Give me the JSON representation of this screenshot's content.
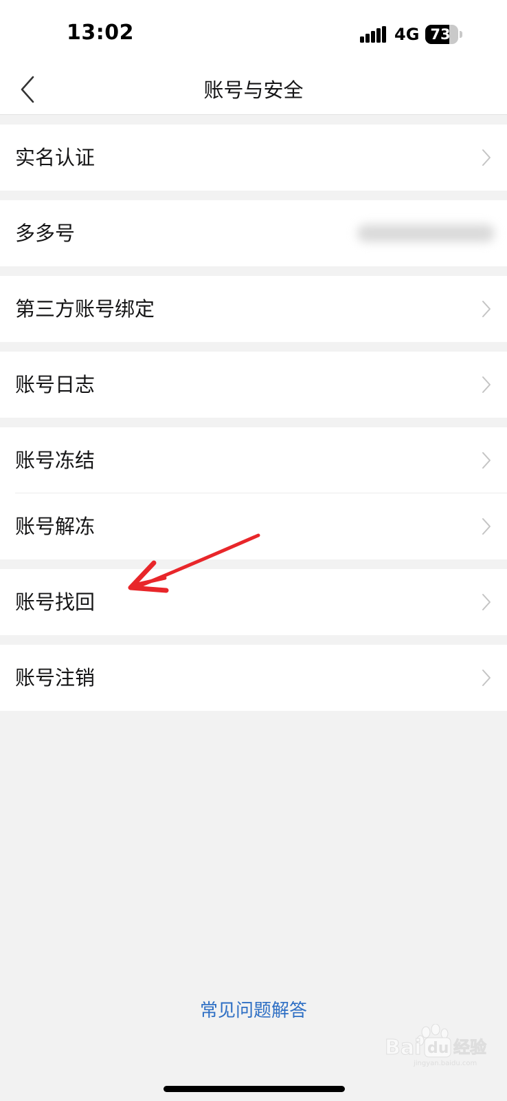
{
  "status_bar": {
    "time": "13:02",
    "network": "4G",
    "battery_percent": "73",
    "battery_level": 0.73
  },
  "nav": {
    "title": "账号与安全",
    "back_icon": "chevron-left-icon"
  },
  "menu": {
    "real_name": "实名认证",
    "duoduo_id": "多多号",
    "third_party": "第三方账号绑定",
    "account_log": "账号日志",
    "freeze": "账号冻结",
    "unfreeze": "账号解冻",
    "recover": "账号找回",
    "cancel": "账号注销"
  },
  "footer": {
    "faq": "常见问题解答"
  },
  "colors": {
    "background": "#f2f2f2",
    "card": "#ffffff",
    "link": "#2e6fc4",
    "annotation_arrow": "#e8262a"
  },
  "watermark": {
    "brand": "Baidu经验",
    "url": "jingyan.baidu.com"
  }
}
